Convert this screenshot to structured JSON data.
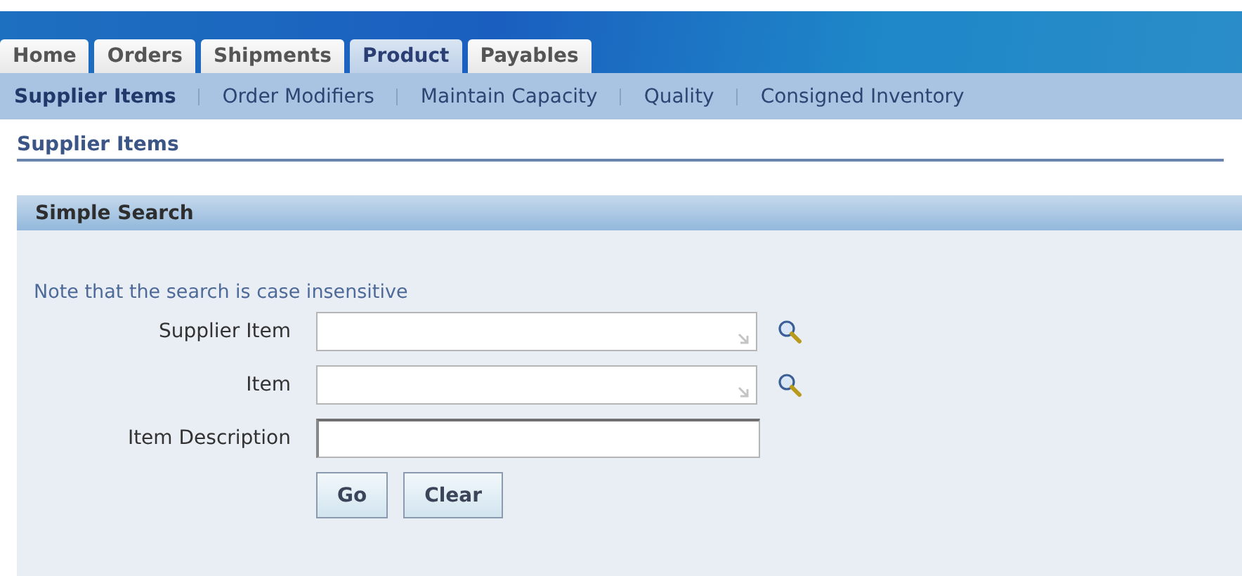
{
  "tabs": [
    {
      "label": "Home",
      "selected": false
    },
    {
      "label": "Orders",
      "selected": false
    },
    {
      "label": "Shipments",
      "selected": false
    },
    {
      "label": "Product",
      "selected": true
    },
    {
      "label": "Payables",
      "selected": false
    }
  ],
  "subtabs": [
    {
      "label": "Supplier Items",
      "selected": true
    },
    {
      "label": "Order Modifiers",
      "selected": false
    },
    {
      "label": "Maintain Capacity",
      "selected": false
    },
    {
      "label": "Quality",
      "selected": false
    },
    {
      "label": "Consigned Inventory",
      "selected": false
    }
  ],
  "page_title": "Supplier Items",
  "panel": {
    "title": "Simple Search",
    "note": "Note that the search is case insensitive",
    "fields": [
      {
        "label": "Supplier Item",
        "kind": "lookup"
      },
      {
        "label": "Item",
        "kind": "lookup"
      },
      {
        "label": "Item Description",
        "kind": "text"
      }
    ],
    "buttons": [
      "Go",
      "Clear"
    ]
  }
}
